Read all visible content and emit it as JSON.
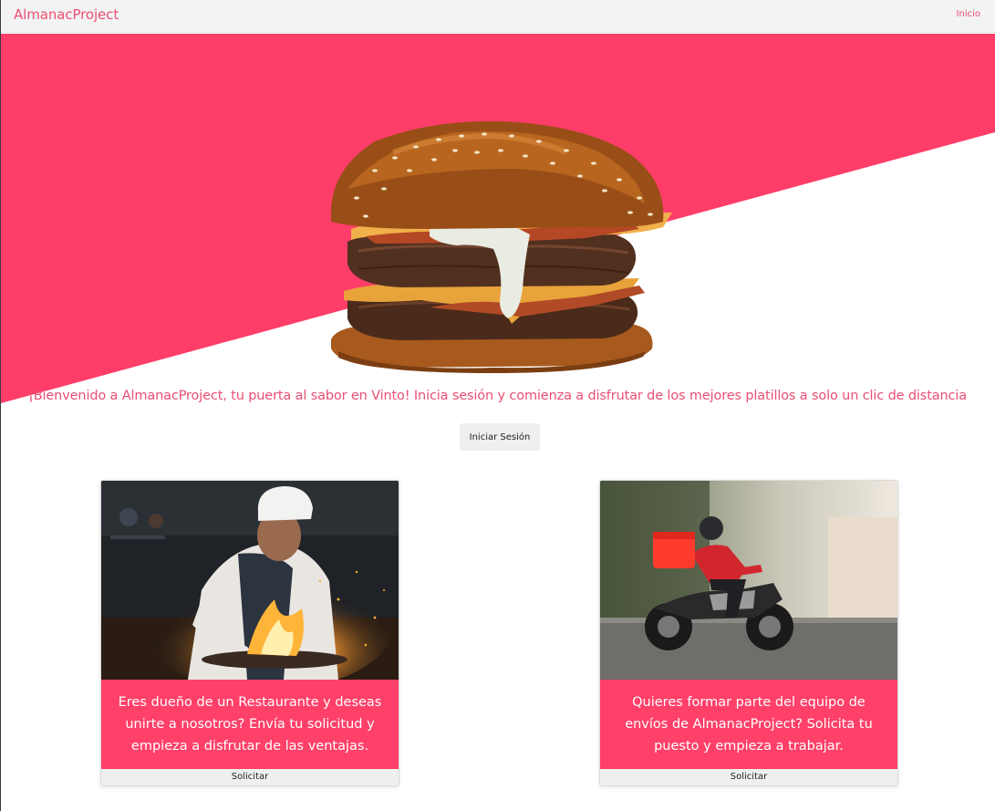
{
  "navbar": {
    "brand": "AlmanacProject",
    "link_home": "Inicio"
  },
  "hero": {
    "welcome_text": "¡Bienvenido a AlmanacProject, tu puerta al sabor en Vinto! Inicia sesión y comienza a disfrutar de los mejores platillos a solo un clic de distancia",
    "login_button": "Iniciar Sesión"
  },
  "cards": [
    {
      "text": "Eres dueño de un Restaurante y deseas unirte a nosotros? Envía tu solicitud y empieza a disfrutar de las ventajas.",
      "button": "Solicitar"
    },
    {
      "text": "Quieres formar parte del equipo de envíos de AlmanacProject? Solicita tu puesto y empieza a trabajar.",
      "button": "Solicitar"
    }
  ],
  "colors": {
    "accent": "#ff4069",
    "text_accent": "#e94f72",
    "navbar_bg": "#f3f3f3"
  }
}
